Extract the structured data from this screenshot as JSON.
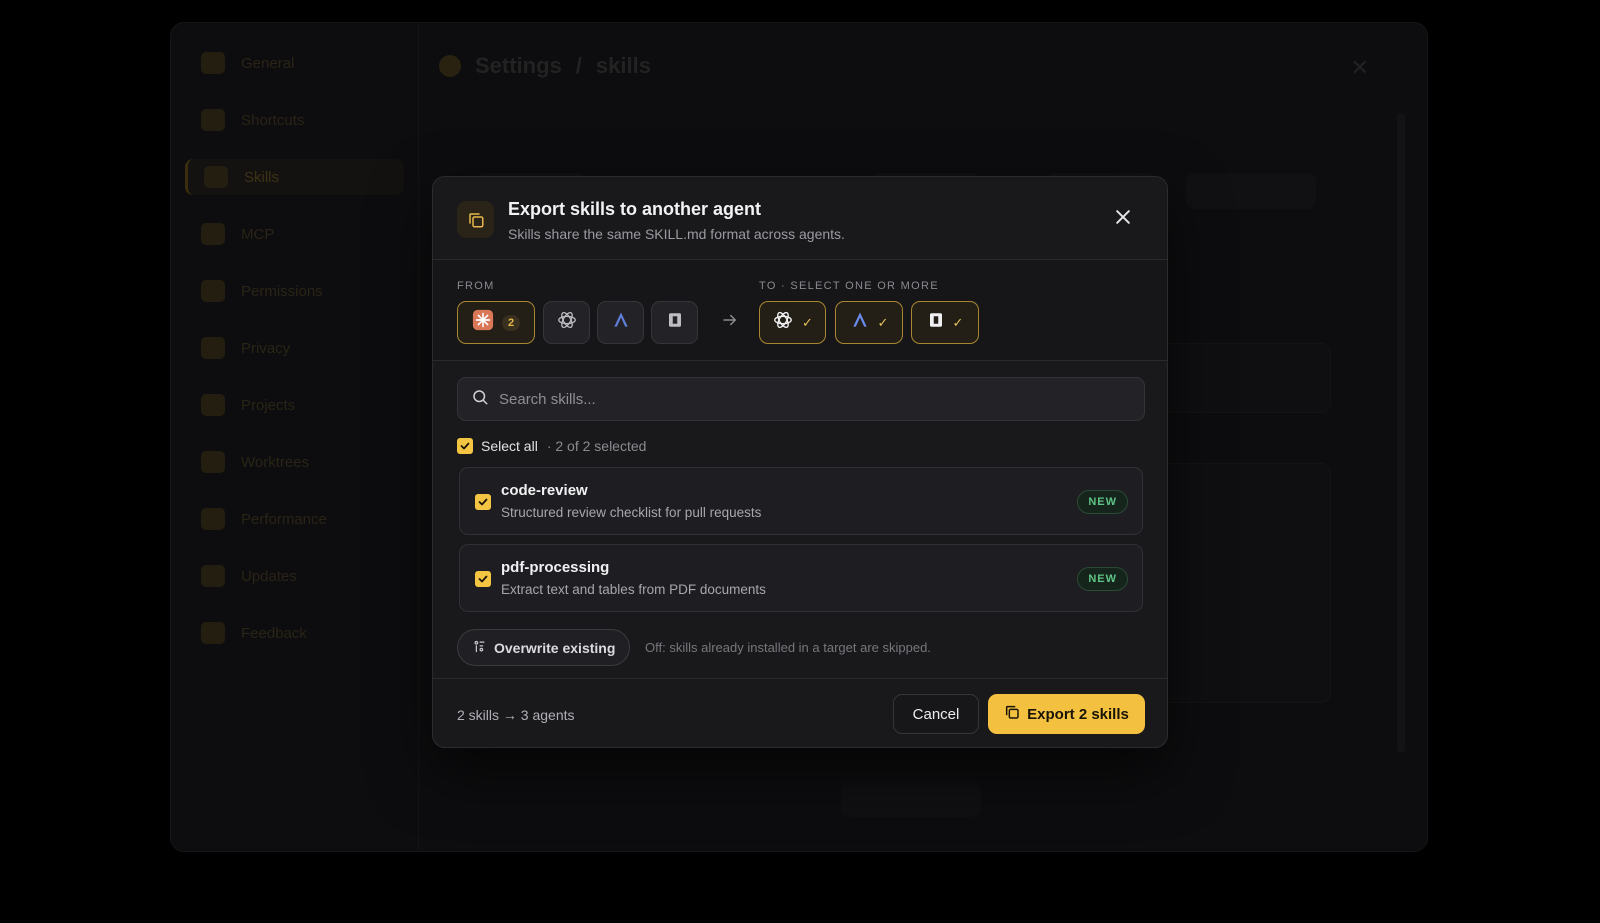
{
  "background": {
    "sidebar_items": [
      "General",
      "Shortcuts",
      "Skills",
      "MCP",
      "Permissions",
      "Privacy",
      "Projects",
      "Worktrees",
      "Performance",
      "Updates",
      "Feedback"
    ],
    "breadcrumb_root": "Settings",
    "breadcrumb_current": "skills"
  },
  "modal": {
    "title": "Export skills to another agent",
    "subtitle": "Skills share the same SKILL.md format across agents.",
    "header_icon": "copy-icon",
    "from_label": "FROM",
    "to_label": "TO · SELECT ONE OR MORE",
    "from_agents": [
      {
        "icon": "claude-icon",
        "count": "2",
        "selected": true
      },
      {
        "icon": "openai-icon",
        "selected": false
      },
      {
        "icon": "navigator-icon",
        "selected": false
      },
      {
        "icon": "terminal-square-icon",
        "selected": false
      }
    ],
    "to_agents": [
      {
        "icon": "openai-icon",
        "checked": true
      },
      {
        "icon": "navigator-icon",
        "checked": true
      },
      {
        "icon": "terminal-square-icon",
        "checked": true
      }
    ],
    "search": {
      "placeholder": "Search skills...",
      "value": ""
    },
    "select_all": {
      "label": "Select all",
      "count": "· 2 of 2 selected",
      "checked": true
    },
    "skills": [
      {
        "name": "code-review",
        "description": "Structured review checklist for pull requests",
        "badge": "NEW",
        "checked": true
      },
      {
        "name": "pdf-processing",
        "description": "Extract text and tables from PDF documents",
        "badge": "NEW",
        "checked": true
      }
    ],
    "overwrite": {
      "label": "Overwrite existing",
      "note": "Off: skills already installed in a target are skipped.",
      "enabled": false
    },
    "footer": {
      "summary": "2 skills → 3 agents",
      "cancel_label": "Cancel",
      "export_label": "Export 2 skills"
    }
  },
  "colors": {
    "accent": "#f3c13f",
    "modal_bg": "#19191c",
    "new_badge": "#5fc385",
    "claude": "#d97757"
  }
}
